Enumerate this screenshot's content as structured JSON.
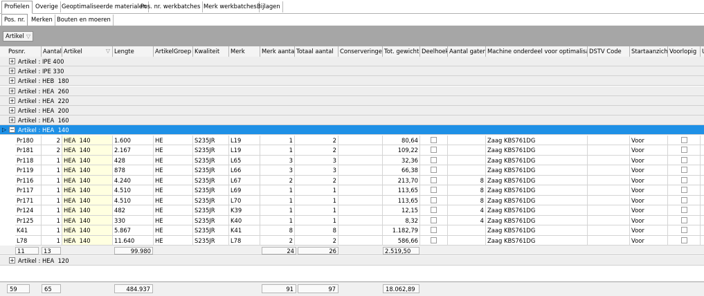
{
  "tabs_top": [
    "Profielen",
    "Overige",
    "Geoptimaliseerde materialen",
    "Pos. nr. werkbatches",
    "Merk werkbatches",
    "Bijlagen"
  ],
  "tabs_sub": [
    "Pos. nr.",
    "Merken",
    "Bouten en moeren"
  ],
  "group_by": "Artikel",
  "columns": [
    "Posnr.",
    "Aantal",
    "Artikel",
    "Lengte",
    "ArtikelGroep",
    "Kwaliteit",
    "Merk",
    "Merk aantal",
    "Totaal aantal",
    "Conserveringen",
    "Tot. gewicht",
    "Deelhoek",
    "Aantal gaten",
    "Machine onderdeel voor optimalisatie",
    "DSTV Code",
    "Startaanzicht",
    "Voorlopig",
    "U"
  ],
  "groups_before": [
    "Artikel : IPE 400",
    "Artikel : IPE 330",
    "Artikel : HEB  180",
    "Artikel : HEA  260",
    "Artikel : HEA  220",
    "Artikel : HEA  200",
    "Artikel : HEA  160"
  ],
  "expanded_group": "Artikel : HEA  140",
  "rows": [
    {
      "posnr": "Pr180",
      "aantal": "2",
      "artikel": "HEA  140",
      "lengte": "1.600",
      "groep": "HE",
      "kwaliteit": "S235JR",
      "merk": "L19",
      "merk_aantal": "1",
      "totaal": "2",
      "gewicht": "80,64",
      "gaten": "",
      "machine": "Zaag KBS761DG",
      "start": "Voor"
    },
    {
      "posnr": "Pr181",
      "aantal": "2",
      "artikel": "HEA  140",
      "lengte": "2.167",
      "groep": "HE",
      "kwaliteit": "S235JR",
      "merk": "L19",
      "merk_aantal": "1",
      "totaal": "2",
      "gewicht": "109,22",
      "gaten": "",
      "machine": "Zaag KBS761DG",
      "start": "Voor"
    },
    {
      "posnr": "Pr118",
      "aantal": "1",
      "artikel": "HEA  140",
      "lengte": "428",
      "groep": "HE",
      "kwaliteit": "S235JR",
      "merk": "L65",
      "merk_aantal": "3",
      "totaal": "3",
      "gewicht": "32,36",
      "gaten": "",
      "machine": "Zaag KBS761DG",
      "start": "Voor"
    },
    {
      "posnr": "Pr119",
      "aantal": "1",
      "artikel": "HEA  140",
      "lengte": "878",
      "groep": "HE",
      "kwaliteit": "S235JR",
      "merk": "L66",
      "merk_aantal": "3",
      "totaal": "3",
      "gewicht": "66,38",
      "gaten": "",
      "machine": "Zaag KBS761DG",
      "start": "Voor"
    },
    {
      "posnr": "Pr116",
      "aantal": "1",
      "artikel": "HEA  140",
      "lengte": "4.240",
      "groep": "HE",
      "kwaliteit": "S235JR",
      "merk": "L67",
      "merk_aantal": "2",
      "totaal": "2",
      "gewicht": "213,70",
      "gaten": "8",
      "machine": "Zaag KBS761DG",
      "start": "Voor"
    },
    {
      "posnr": "Pr117",
      "aantal": "1",
      "artikel": "HEA  140",
      "lengte": "4.510",
      "groep": "HE",
      "kwaliteit": "S235JR",
      "merk": "L69",
      "merk_aantal": "1",
      "totaal": "1",
      "gewicht": "113,65",
      "gaten": "8",
      "machine": "Zaag KBS761DG",
      "start": "Voor"
    },
    {
      "posnr": "Pr171",
      "aantal": "1",
      "artikel": "HEA  140",
      "lengte": "4.510",
      "groep": "HE",
      "kwaliteit": "S235JR",
      "merk": "L70",
      "merk_aantal": "1",
      "totaal": "1",
      "gewicht": "113,65",
      "gaten": "8",
      "machine": "Zaag KBS761DG",
      "start": "Voor"
    },
    {
      "posnr": "Pr124",
      "aantal": "1",
      "artikel": "HEA  140",
      "lengte": "482",
      "groep": "HE",
      "kwaliteit": "S235JR",
      "merk": "K39",
      "merk_aantal": "1",
      "totaal": "1",
      "gewicht": "12,15",
      "gaten": "4",
      "machine": "Zaag KBS761DG",
      "start": "Voor"
    },
    {
      "posnr": "Pr125",
      "aantal": "1",
      "artikel": "HEA  140",
      "lengte": "330",
      "groep": "HE",
      "kwaliteit": "S235JR",
      "merk": "K40",
      "merk_aantal": "1",
      "totaal": "1",
      "gewicht": "8,32",
      "gaten": "4",
      "machine": "Zaag KBS761DG",
      "start": "Voor"
    },
    {
      "posnr": "K41",
      "aantal": "1",
      "artikel": "HEA  140",
      "lengte": "5.867",
      "groep": "HE",
      "kwaliteit": "S235JR",
      "merk": "K41",
      "merk_aantal": "8",
      "totaal": "8",
      "gewicht": "1.182,79",
      "gaten": "",
      "machine": "Zaag KBS761DG",
      "start": "Voor"
    },
    {
      "posnr": "L78",
      "aantal": "1",
      "artikel": "HEA  140",
      "lengte": "11.640",
      "groep": "HE",
      "kwaliteit": "S235JR",
      "merk": "L78",
      "merk_aantal": "2",
      "totaal": "2",
      "gewicht": "586,66",
      "gaten": "",
      "machine": "Zaag KBS761DG",
      "start": "Voor"
    }
  ],
  "group_summary": {
    "posnr": "11",
    "aantal": "13",
    "lengte": "99.980",
    "merk_aantal": "24",
    "totaal": "26",
    "gewicht": "2.519,50"
  },
  "groups_after": [
    "Artikel : HEA  120"
  ],
  "footer_summary": {
    "posnr": "59",
    "aantal": "65",
    "lengte": "484.937",
    "merk_aantal": "91",
    "totaal": "97",
    "gewicht": "18.062,89"
  },
  "icons": {
    "filter": "funnel-icon",
    "expand": "plus-box-icon",
    "collapse": "minus-box-icon",
    "row_indicator": "triangle-right-icon"
  },
  "colors": {
    "selected_row": "#1e90e6",
    "group_panel": "#a6a6a6",
    "highlight_column": "#ffffe0"
  }
}
